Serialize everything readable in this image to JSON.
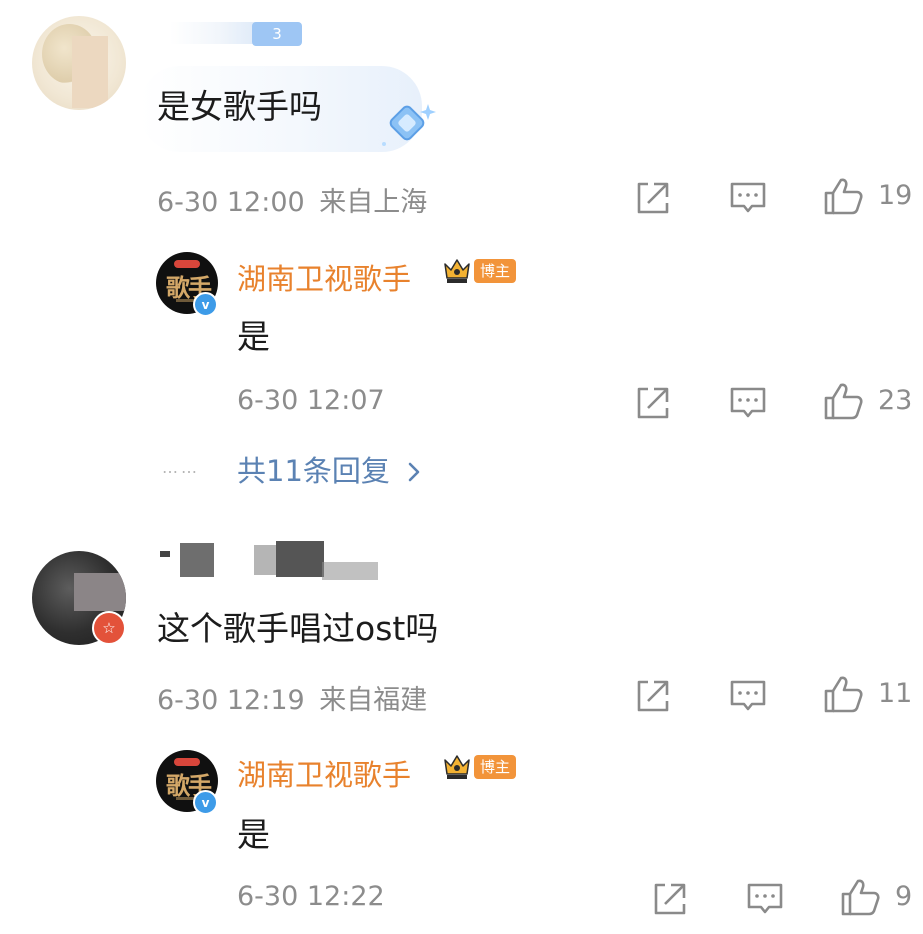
{
  "comments": [
    {
      "level_tag": "3",
      "text": "是女歌手吗",
      "time": "6-30 12:00",
      "location": "来自上海",
      "like_count": "19",
      "reply": {
        "author": "湖南卫视歌手",
        "badge": "博主",
        "text": "是",
        "time": "6-30 12:07",
        "like_count": "23"
      },
      "more_replies": "共11条回复",
      "dots": "……"
    },
    {
      "text": "这个歌手唱过ost吗",
      "time": "6-30 12:19",
      "location": "来自福建",
      "like_count": "11",
      "reply": {
        "author": "湖南卫视歌手",
        "badge": "博主",
        "text": "是",
        "time": "6-30 12:22",
        "like_count": "9"
      }
    }
  ],
  "icons": {
    "share": "share-icon",
    "comment": "comment-icon",
    "like": "thumbs-up-icon",
    "verified": "verified-v-icon",
    "crown": "crown-icon",
    "chevron": "chevron-right-icon"
  },
  "colors": {
    "author": "#e8822d",
    "link": "#5b82b3",
    "meta": "#8c8c8c",
    "badge": "#f2943a"
  }
}
